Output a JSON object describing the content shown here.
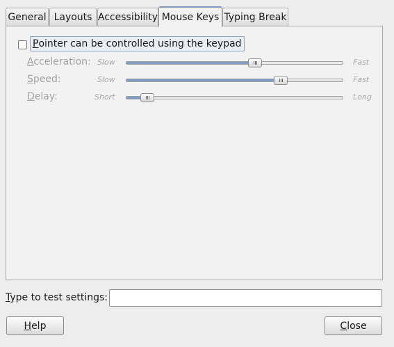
{
  "tabs": [
    {
      "label": "General",
      "active": false
    },
    {
      "label": "Layouts",
      "active": false
    },
    {
      "label": "Accessibility",
      "active": false
    },
    {
      "label": "Mouse Keys",
      "active": true
    },
    {
      "label": "Typing Break",
      "active": false
    }
  ],
  "mouse_keys": {
    "pointer_checkbox": {
      "checked": false,
      "label_first": "P",
      "label_rest": "ointer can be controlled using the keypad"
    },
    "acceleration": {
      "label_first": "A",
      "label_rest": "cceleration:",
      "min_label": "Slow",
      "max_label": "Fast",
      "value_fraction": 0.6
    },
    "speed": {
      "label_first": "S",
      "label_rest": "peed:",
      "min_label": "Slow",
      "max_label": "Fast",
      "value_fraction": 0.73
    },
    "delay": {
      "label_first": "D",
      "label_rest": "elay:",
      "min_label": "Short",
      "max_label": "Long",
      "value_fraction": 0.07
    }
  },
  "test": {
    "label_first": "T",
    "label_rest": "ype to test settings:",
    "value": ""
  },
  "buttons": {
    "help": {
      "label_first": "H",
      "label_rest": "elp"
    },
    "close": {
      "label_first": "C",
      "label_rest": "lose"
    }
  },
  "colors": {
    "slider_fill": "#7f9bc8",
    "active_tab_top": "#7f99bd"
  }
}
